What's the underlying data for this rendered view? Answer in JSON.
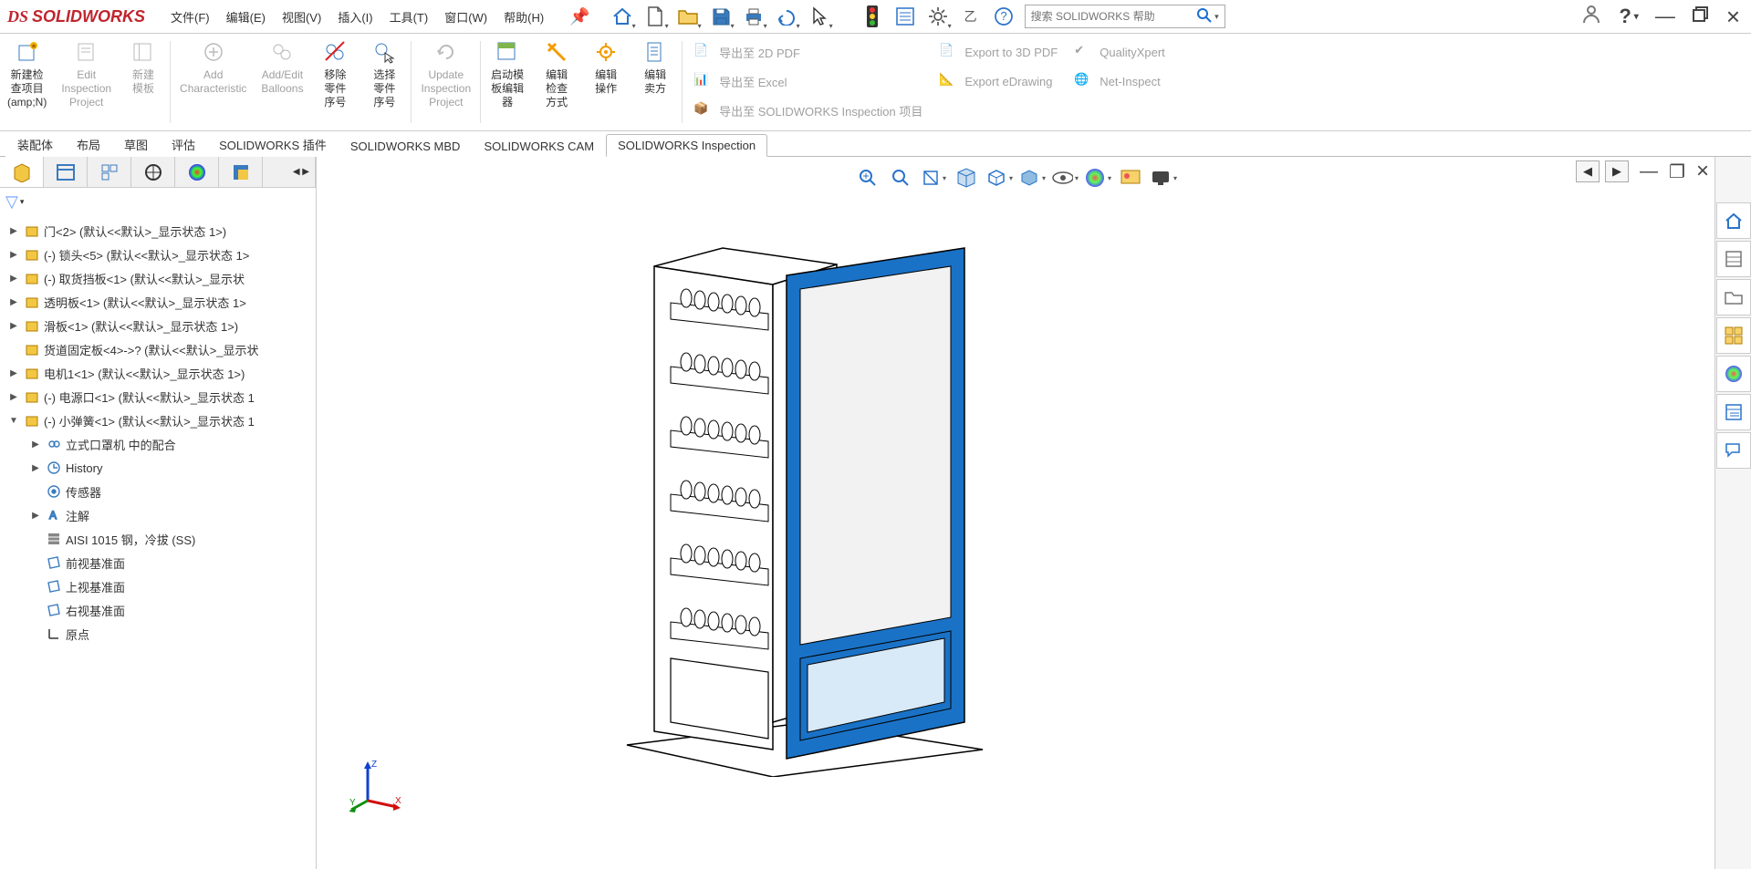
{
  "app": {
    "brand": "SOLIDWORKS"
  },
  "menu": {
    "file": "文件(F)",
    "edit": "编辑(E)",
    "view": "视图(V)",
    "insert": "插入(I)",
    "tools": "工具(T)",
    "window": "窗口(W)",
    "help": "帮助(H)"
  },
  "search": {
    "placeholder": "搜索 SOLIDWORKS 帮助"
  },
  "ribbon": {
    "new_insp": "新建检\n查项目\n(amp;N)",
    "edit_insp": "Edit\nInspection\nProject",
    "new_tpl": "新建\n模板",
    "add_char": "Add\nCharacteristic",
    "add_edit_balloons": "Add/Edit\nBalloons",
    "remove_sn": "移除\n零件\n序号",
    "select_sn": "选择\n零件\n序号",
    "update_insp": "Update\nInspection\nProject",
    "launch_tpl_editor": "启动模\n板编辑\n器",
    "edit_insp_method": "编辑\n检查\n方式",
    "edit_op": "编辑\n操作",
    "edit_vendor": "编辑\n卖方",
    "exp_2dpdf": "导出至 2D PDF",
    "exp_excel": "导出至 Excel",
    "exp_swi": "导出至 SOLIDWORKS Inspection 项目",
    "exp_3dpdf": "Export to 3D PDF",
    "exp_edrawing": "Export eDrawing",
    "qualityxpert": "QualityXpert",
    "netinspect": "Net-Inspect"
  },
  "cm_tabs": {
    "assembly": "装配体",
    "layout": "布局",
    "sketch": "草图",
    "evaluate": "评估",
    "sw_addins": "SOLIDWORKS 插件",
    "sw_mbd": "SOLIDWORKS MBD",
    "sw_cam": "SOLIDWORKS CAM",
    "sw_inspection": "SOLIDWORKS Inspection"
  },
  "tree": {
    "items": [
      {
        "arrow": "▶",
        "type": "part",
        "label": "门<2> (默认<<默认>_显示状态 1>)"
      },
      {
        "arrow": "▶",
        "type": "part",
        "label": "(-) 锁头<5> (默认<<默认>_显示状态 1>"
      },
      {
        "arrow": "▶",
        "type": "part",
        "label": "(-) 取货挡板<1> (默认<<默认>_显示状"
      },
      {
        "arrow": "▶",
        "type": "part",
        "label": "透明板<1> (默认<<默认>_显示状态 1>"
      },
      {
        "arrow": "▶",
        "type": "part",
        "label": "滑板<1> (默认<<默认>_显示状态 1>)"
      },
      {
        "arrow": "",
        "type": "part",
        "label": "货道固定板<4>->? (默认<<默认>_显示状"
      },
      {
        "arrow": "▶",
        "type": "part",
        "label": "电机1<1> (默认<<默认>_显示状态 1>)"
      },
      {
        "arrow": "▶",
        "type": "part",
        "label": "(-) 电源口<1> (默认<<默认>_显示状态 1"
      },
      {
        "arrow": "▼",
        "type": "part",
        "label": "(-) 小弹簧<1> (默认<<默认>_显示状态 1"
      }
    ],
    "sub": [
      {
        "arrow": "▶",
        "type": "mates",
        "label": "立式口罩机 中的配合"
      },
      {
        "arrow": "▶",
        "type": "history",
        "label": "History"
      },
      {
        "arrow": "",
        "type": "sensor",
        "label": "传感器"
      },
      {
        "arrow": "▶",
        "type": "annot",
        "label": "注解"
      },
      {
        "arrow": "",
        "type": "material",
        "label": "AISI 1015 钢，冷拔 (SS)"
      },
      {
        "arrow": "",
        "type": "plane",
        "label": "前视基准面"
      },
      {
        "arrow": "",
        "type": "plane",
        "label": "上视基准面"
      },
      {
        "arrow": "",
        "type": "plane",
        "label": "右视基准面"
      },
      {
        "arrow": "",
        "type": "origin",
        "label": "原点"
      }
    ]
  },
  "triad": {
    "x": "X",
    "y": "Y",
    "z": "Z"
  }
}
